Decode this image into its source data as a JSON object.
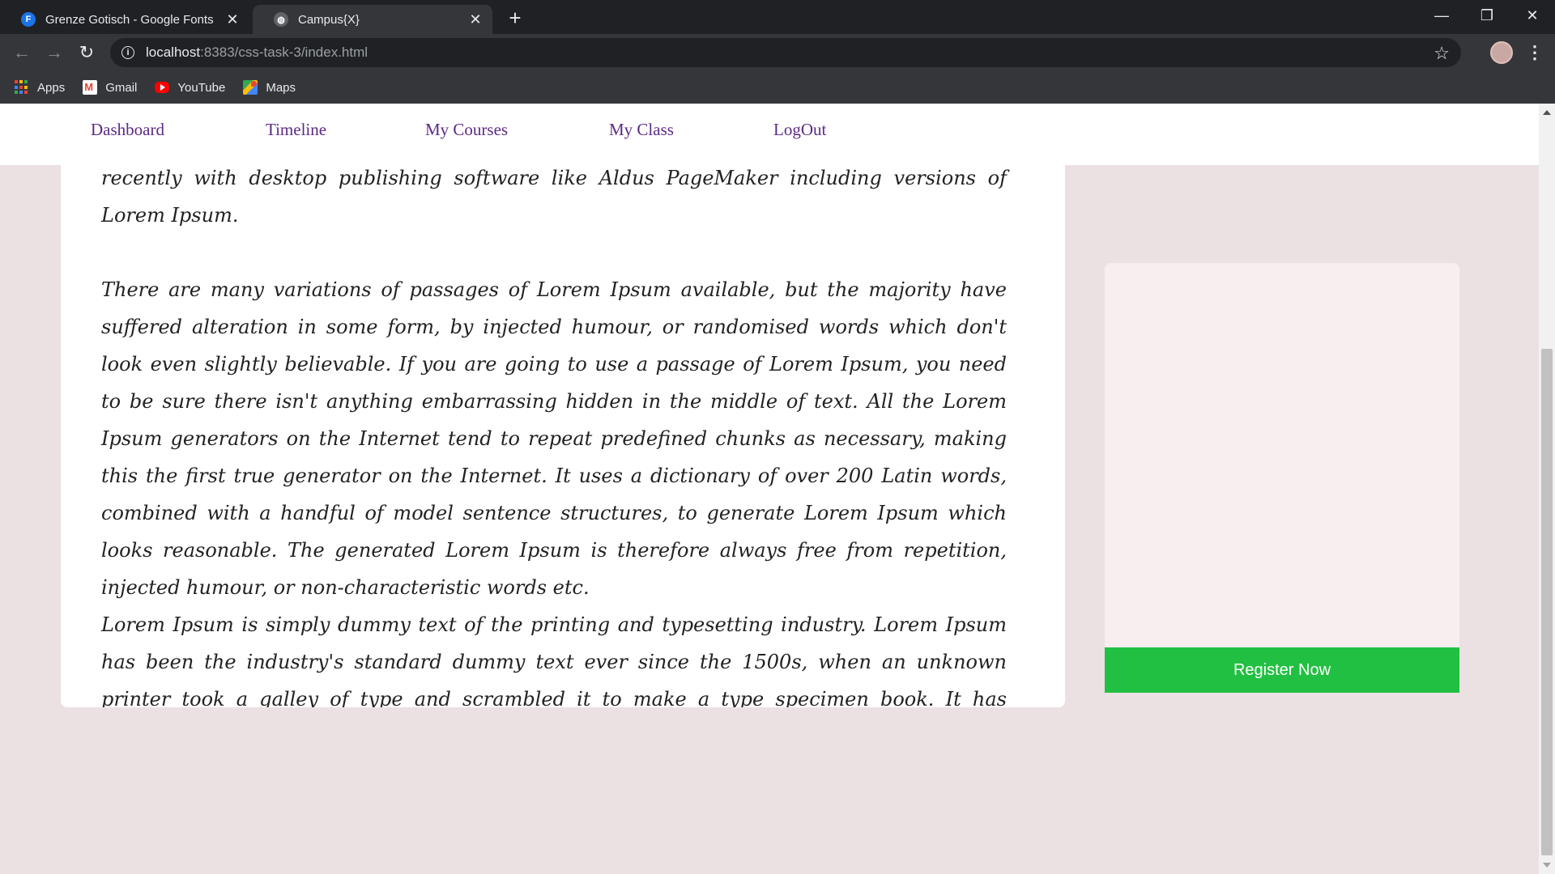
{
  "browser": {
    "tabs": [
      {
        "title": "Grenze Gotisch - Google Fonts",
        "favicon_letter": "F",
        "active": false
      },
      {
        "title": "Campus{X}",
        "active": true
      }
    ],
    "new_tab_symbol": "+",
    "url_host": "localhost",
    "url_path": ":8383/css-task-3/index.html",
    "bookmarks": [
      {
        "label": "Apps",
        "icon": "apps-grid-icon"
      },
      {
        "label": "Gmail",
        "icon": "gmail-icon"
      },
      {
        "label": "YouTube",
        "icon": "youtube-icon"
      },
      {
        "label": "Maps",
        "icon": "maps-icon"
      }
    ]
  },
  "page": {
    "nav": {
      "items": [
        "Dashboard",
        "Timeline",
        "My Courses",
        "My Class",
        "LogOut"
      ]
    },
    "content": {
      "paragraphs": [
        "into electronic typesetting, remaining essentially unchanged. It was popularised in the 1960s with the release of Letraset sheets containing Lorem Ipsum passages, and more recently with desktop publishing software like Aldus PageMaker including versions of Lorem Ipsum.",
        "There are many variations of passages of Lorem Ipsum available, but the majority have suffered alteration in some form, by injected humour, or randomised words which don't look even slightly believable. If you are going to use a passage of Lorem Ipsum, you need to be sure there isn't anything embarrassing hidden in the middle of text. All the Lorem Ipsum generators on the Internet tend to repeat predefined chunks as necessary, making this the first true generator on the Internet. It uses a dictionary of over 200 Latin words, combined with a handful of model sentence structures, to generate Lorem Ipsum which looks reasonable. The generated Lorem Ipsum is therefore always free from repetition, injected humour, or non-characteristic words etc.",
        "Lorem Ipsum is simply dummy text of the printing and typesetting industry. Lorem Ipsum has been the industry's standard dummy text ever since the 1500s, when an unknown printer took a galley of type and scrambled it to make a type specimen book. It has survived not only five centuries, but also the leap"
      ]
    },
    "sidebar": {
      "register_label": "Register Now"
    },
    "colors": {
      "nav_link": "#5b2a86",
      "page_background": "#ebe0e2",
      "side_card": "#f9eeef",
      "register_button": "#22c042"
    }
  }
}
